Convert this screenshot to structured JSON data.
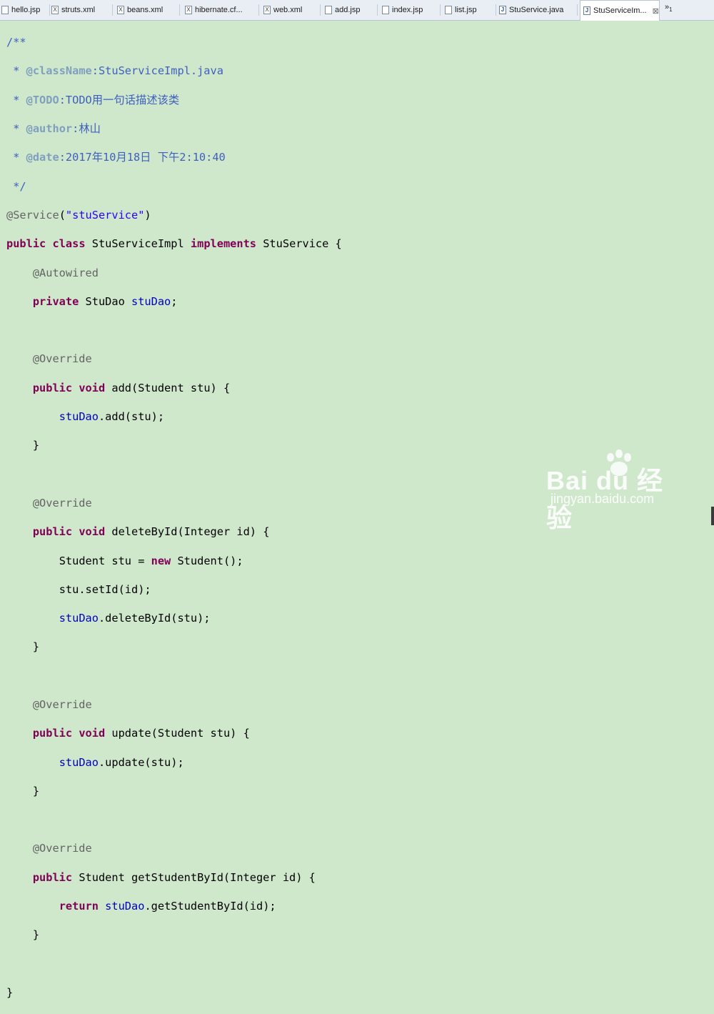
{
  "tabs": [
    {
      "label": "hello.jsp",
      "icon": "jsp-file-icon"
    },
    {
      "label": "struts.xml",
      "icon": "xml-file-icon"
    },
    {
      "label": "beans.xml",
      "icon": "xml-file-icon"
    },
    {
      "label": "hibernate.cf...",
      "icon": "xml-file-icon"
    },
    {
      "label": "web.xml",
      "icon": "xml-file-icon"
    },
    {
      "label": "add.jsp",
      "icon": "jsp-file-icon"
    },
    {
      "label": "index.jsp",
      "icon": "jsp-file-icon"
    },
    {
      "label": "list.jsp",
      "icon": "jsp-file-icon"
    },
    {
      "label": "StuService.java",
      "icon": "java-file-icon"
    },
    {
      "label": "StuServiceIm...",
      "icon": "java-file-icon",
      "active": true,
      "close": "⊠"
    }
  ],
  "overflow": {
    "symbol": "»",
    "count": "1"
  },
  "code": {
    "l1": "/**",
    "l2_star": " * ",
    "l2_tag": "@className",
    "l2_text": ":StuServiceImpl.java",
    "l3_star": " * ",
    "l3_tag": "@TODO",
    "l3_text": ":TODO用一句话描述该类",
    "l4_star": " * ",
    "l4_tag": "@author",
    "l4_text": ":林山",
    "l5_star": " * ",
    "l5_tag": "@date",
    "l5_text": ":2017年10月18日 下午2:10:40",
    "l6": " */",
    "l7_ann": "@Service",
    "l7_open": "(",
    "l7_str": "\"stuService\"",
    "l7_close": ")",
    "l8_kw1": "public",
    "l8_kw2": "class",
    "l8_name": " StuServiceImpl ",
    "l8_kw3": "implements",
    "l8_rest": " StuService {",
    "l9_ann": "@Autowired",
    "l10_kw": "private",
    "l10_type": " StuDao ",
    "l10_fld": "stuDao",
    "l10_end": ";",
    "l12_ann": "@Override",
    "l13_kw1": "public",
    "l13_kw2": "void",
    "l13_rest": " add(Student stu) {",
    "l14_fld": "stuDao",
    "l14_rest": ".add(stu);",
    "l15": "}",
    "l17_ann": "@Override",
    "l18_kw1": "public",
    "l18_kw2": "void",
    "l18_rest": " deleteById(Integer id) {",
    "l19_a": "Student stu = ",
    "l19_kw": "new",
    "l19_b": " Student();",
    "l20": "stu.setId(id);",
    "l21_fld": "stuDao",
    "l21_rest": ".deleteById(stu);",
    "l22": "}",
    "l24_ann": "@Override",
    "l25_kw1": "public",
    "l25_kw2": "void",
    "l25_rest": " update(Student stu) {",
    "l26_fld": "stuDao",
    "l26_rest": ".update(stu);",
    "l27": "}",
    "l29_ann": "@Override",
    "l30_kw1": "public",
    "l30_rest": " Student getStudentById(Integer id) {",
    "l31_kw": "return",
    "l31_fld": "stuDao",
    "l31_rest": ".getStudentById(id);",
    "l32": "}",
    "l34": "}"
  },
  "watermark": {
    "brand": "Bai du 经验",
    "url": "jingyan.baidu.com"
  },
  "colors": {
    "editor_bg": "#cfe8cc",
    "keyword": "#7f0055",
    "comment": "#3f5fbf",
    "string": "#2a00ff",
    "field": "#0000c0",
    "annotation": "#646464"
  }
}
